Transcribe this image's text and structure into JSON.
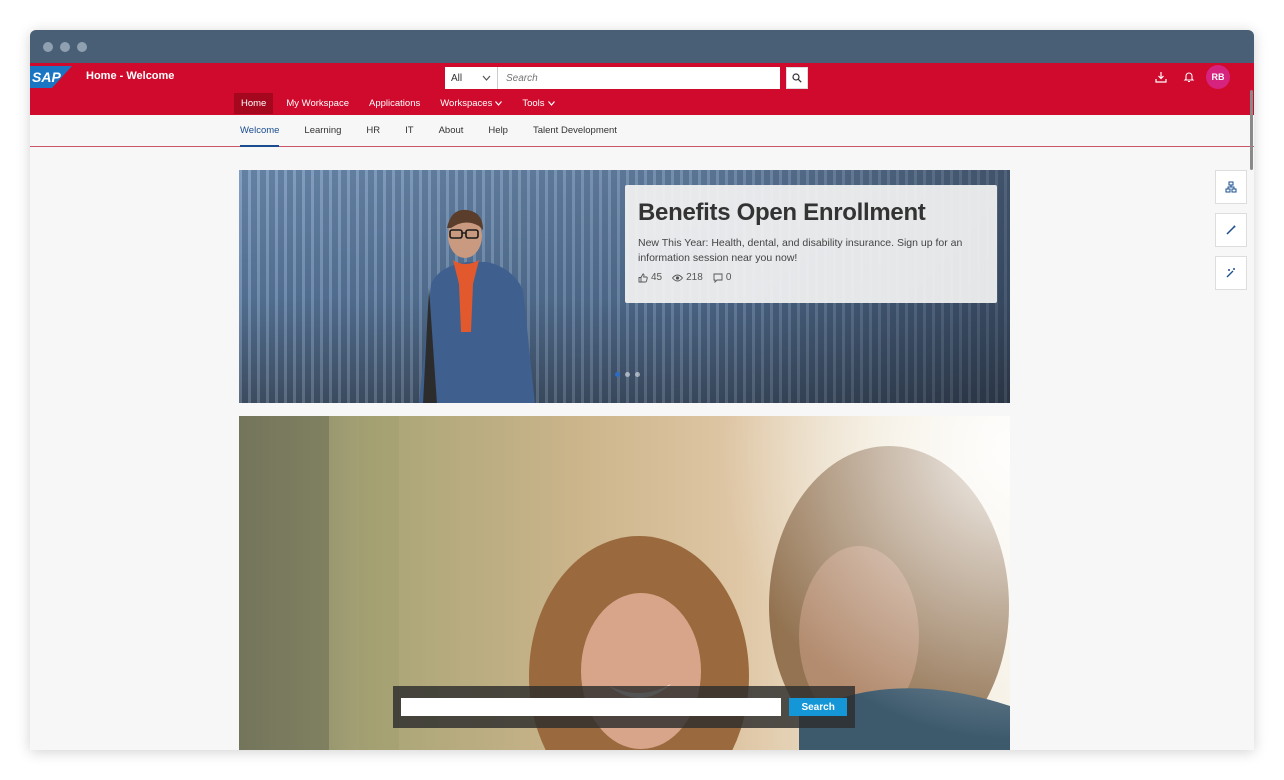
{
  "shell": {
    "brand_logo_text": "SAP",
    "app_title": "Home - Welcome",
    "search": {
      "scope": "All",
      "placeholder": "Search"
    },
    "user_initials": "RB",
    "colors": {
      "shell_bg": "#cf0a2c",
      "active_tab_bg": "#a5071f",
      "avatar_bg": "#d6237d",
      "logo_blue": "#1a75c2"
    }
  },
  "topnav": {
    "items": [
      {
        "label": "Home",
        "active": true
      },
      {
        "label": "My Workspace"
      },
      {
        "label": "Applications"
      },
      {
        "label": "Workspaces",
        "has_dropdown": true
      },
      {
        "label": "Tools",
        "has_dropdown": true
      }
    ]
  },
  "subnav": {
    "items": [
      {
        "label": "Welcome",
        "active": true
      },
      {
        "label": "Learning"
      },
      {
        "label": "HR"
      },
      {
        "label": "IT"
      },
      {
        "label": "About"
      },
      {
        "label": "Help"
      },
      {
        "label": "Talent Development"
      }
    ]
  },
  "side_actions": [
    "hierarchy-icon",
    "pencil-icon",
    "magic-wand-icon"
  ],
  "hero": {
    "title": "Benefits Open Enrollment",
    "description": "New This Year: Health, dental, and disability insurance. Sign up for an information session near you now!",
    "stats": {
      "likes": "45",
      "views": "218",
      "comments": "0"
    },
    "carousel": {
      "total": 3,
      "active_index": 0
    }
  },
  "photo_search": {
    "button_label": "Search"
  }
}
